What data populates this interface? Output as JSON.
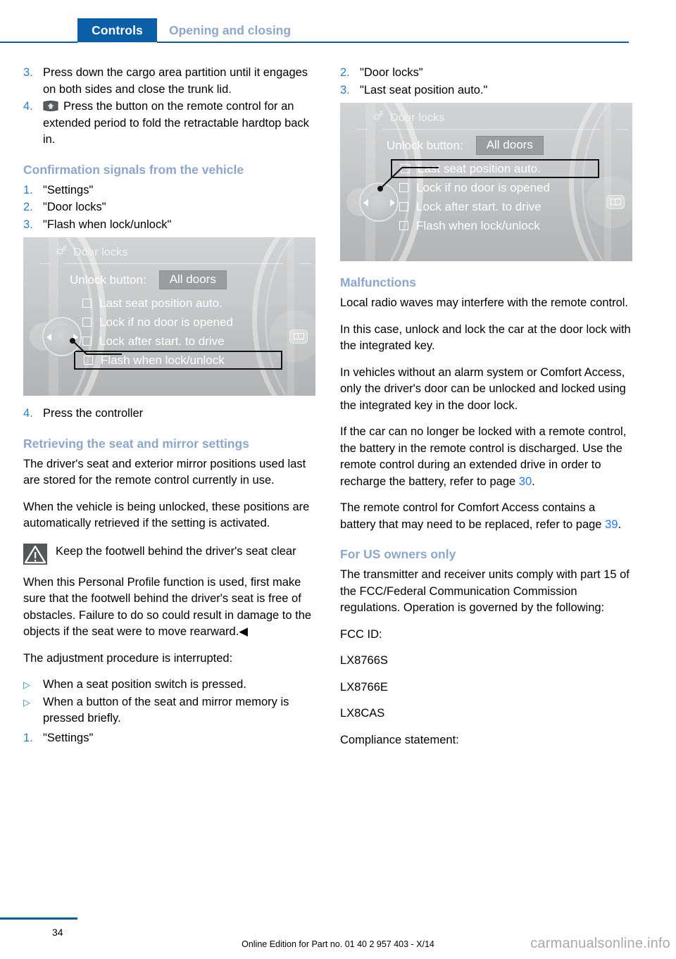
{
  "header": {
    "tab_label": "Controls",
    "section_label": "Opening and closing",
    "tab_bg": "#0a5fa8",
    "section_color": "#8ba7cc"
  },
  "left_column": {
    "steps_top": [
      {
        "marker": "3.",
        "text": "Press down the cargo area partition until it engages on both sides and close the trunk lid."
      },
      {
        "marker": "4.",
        "text": "Press the button on the remote control for an extended period to fold the retractable hardtop back in.",
        "icon": "convertible-top-button-icon"
      }
    ],
    "heading_confirmation": "Confirmation signals from the vehicle",
    "steps_confirmation": [
      {
        "marker": "1.",
        "text": "\"Settings\""
      },
      {
        "marker": "2.",
        "text": "\"Door locks\""
      },
      {
        "marker": "3.",
        "text": "\"Flash when lock/unlock\""
      }
    ],
    "figure_1": {
      "title": "Door locks",
      "title_icon": "gear-settings-icon",
      "unlock_label": "Unlock button:",
      "unlock_value": "All doors",
      "options": [
        {
          "label": "Last seat position auto.",
          "selected": false
        },
        {
          "label": "Lock if no door is opened",
          "selected": false
        },
        {
          "label": "Lock after start. to drive",
          "selected": false
        },
        {
          "label": "Flash when lock/unlock",
          "selected": true
        }
      ]
    },
    "step_after_figure": {
      "marker": "4.",
      "text": "Press the controller"
    },
    "heading_retrieving": "Retrieving the seat and mirror settings",
    "para_1": "The driver's seat and exterior mirror positions used last are stored for the remote control currently in use.",
    "para_2": "When the vehicle is being unlocked, these positions are automatically retrieved if the setting is activated.",
    "warning": {
      "icon": "warning-triangle-icon",
      "title": "Keep the footwell behind the driver's seat clear"
    },
    "para_3": "When this Personal Profile function is used, first make sure that the footwell behind the driver's seat is free of obstacles. Failure to do so could result in damage to the objects if the seat were to move rearward.◀",
    "para_4": "The adjustment procedure is interrupted:",
    "bullets": [
      {
        "marker": "▷",
        "text": "When a seat position switch is pressed."
      },
      {
        "marker": "▷",
        "text": "When a button of the seat and mirror memory is pressed briefly."
      }
    ],
    "step_last": {
      "marker": "1.",
      "text": "\"Settings\""
    }
  },
  "right_column": {
    "steps_top": [
      {
        "marker": "2.",
        "text": "\"Door locks\""
      },
      {
        "marker": "3.",
        "text": "\"Last seat position auto.\""
      }
    ],
    "figure_2": {
      "title": "Door locks",
      "title_icon": "gear-settings-icon",
      "unlock_label": "Unlock button:",
      "unlock_value": "All doors",
      "options": [
        {
          "label": "Last seat position auto.",
          "selected": true
        },
        {
          "label": "Lock if no door is opened",
          "selected": false
        },
        {
          "label": "Lock after start. to drive",
          "selected": false
        },
        {
          "label": "Flash when lock/unlock",
          "selected": false
        }
      ]
    },
    "heading_malfunctions": "Malfunctions",
    "para_1": "Local radio waves may interfere with the remote control.",
    "para_2": "In this case, unlock and lock the car at the door lock with the integrated key.",
    "para_3": "In vehicles without an alarm system or Comfort Access, only the driver's door can be unlocked and locked using the integrated key in the door lock.",
    "para_4_before": "If the car can no longer be locked with a remote control, the battery in the remote control is discharged. Use the remote control during an extended drive in order to recharge the battery, refer to page ",
    "para_4_link": "30",
    "para_4_after": ".",
    "para_5_before": "The remote control for Comfort Access contains a battery that may need to be replaced, refer to page ",
    "para_5_link": "39",
    "para_5_after": ".",
    "heading_us_owners": "For US owners only",
    "para_6": "The transmitter and receiver units comply with part 15 of the FCC/Federal Communication Commission regulations. Operation is governed by the following:",
    "fcc_label": "FCC ID:",
    "fcc_ids": [
      "LX8766S",
      "LX8766E",
      "LX8CAS"
    ],
    "compliance_label": "Compliance statement:"
  },
  "footer": {
    "page_number": "34",
    "edition_text": "Online Edition for Part no. 01 40 2 957 403 - X/14",
    "watermark": "carmanualsonline.info"
  }
}
